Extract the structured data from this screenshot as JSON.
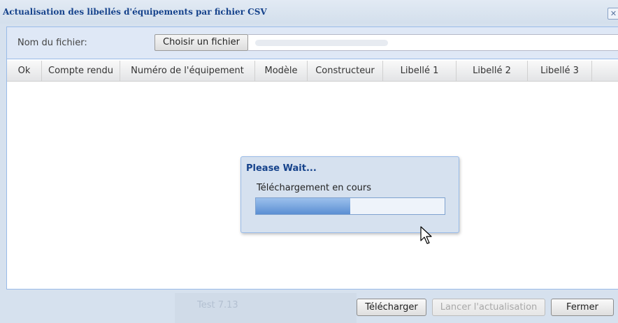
{
  "window": {
    "title": "Actualisation des libellés d'équipements par fichier CSV",
    "close_symbol": "✕"
  },
  "file_row": {
    "label": "Nom du fichier:",
    "choose_button": "Choisir un fichier",
    "file_value": ""
  },
  "grid": {
    "columns": [
      "Ok",
      "Compte rendu",
      "Numéro de l'équipement",
      "Modèle",
      "Constructeur",
      "Libellé 1",
      "Libellé 2",
      "Libellé 3"
    ]
  },
  "footer": {
    "background_text": "Test 7.13",
    "download_button": "Télécharger",
    "start_button": "Lancer l'actualisation",
    "close_button": "Fermer"
  },
  "wait_dialog": {
    "title": "Please Wait...",
    "message": "Téléchargement en cours",
    "progress_fraction": 0.5
  },
  "icons": {
    "cursor": "mouse-pointer-icon",
    "close": "close-icon"
  },
  "colors": {
    "title_blue": "#15428b",
    "border_blue": "#99bbe8",
    "progress_fill": "#5b8fd3"
  }
}
